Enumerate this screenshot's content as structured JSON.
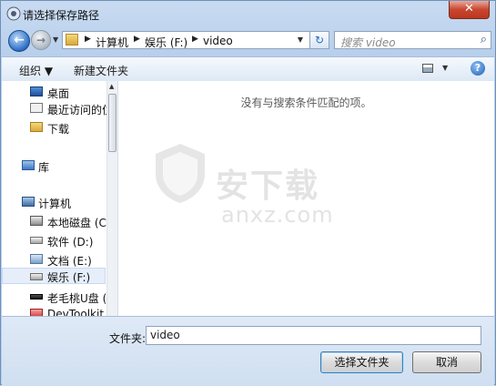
{
  "window": {
    "title": "请选择保存路径",
    "close_label": "✕"
  },
  "nav": {
    "back_label": "←",
    "forward_label": "→",
    "breadcrumb": [
      "计算机",
      "娱乐 (F:)",
      "video"
    ],
    "search_placeholder": "搜索 video"
  },
  "toolbar": {
    "organize_label": "组织 ▼",
    "new_folder_label": "新建文件夹",
    "help_label": "?"
  },
  "sidebar": {
    "items": [
      {
        "label": "桌面",
        "icon": "desktop-icon"
      },
      {
        "label": "最近访问的位",
        "icon": "recent-icon"
      },
      {
        "label": "下载",
        "icon": "download-folder-icon"
      },
      {
        "label": "库",
        "icon": "library-icon"
      },
      {
        "label": "计算机",
        "icon": "computer-icon"
      },
      {
        "label": "本地磁盘 (C:)",
        "icon": "system-drive-icon"
      },
      {
        "label": "软件 (D:)",
        "icon": "drive-icon"
      },
      {
        "label": "文档 (E:)",
        "icon": "network-drive-icon"
      },
      {
        "label": "娱乐 (F:)",
        "icon": "drive-icon",
        "selected": true
      },
      {
        "label": "老毛桃U盘 (L",
        "icon": "usb-drive-icon"
      },
      {
        "label": "DevToolkit (",
        "icon": "devtoolkit-drive-icon"
      }
    ]
  },
  "content": {
    "empty_message": "没有与搜索条件匹配的项。"
  },
  "watermark": {
    "brand": "安下载",
    "domain": "anxz.com"
  },
  "footer": {
    "folder_label": "文件夹:",
    "folder_value": "video",
    "select_button": "选择文件夹",
    "cancel_button": "取消"
  }
}
